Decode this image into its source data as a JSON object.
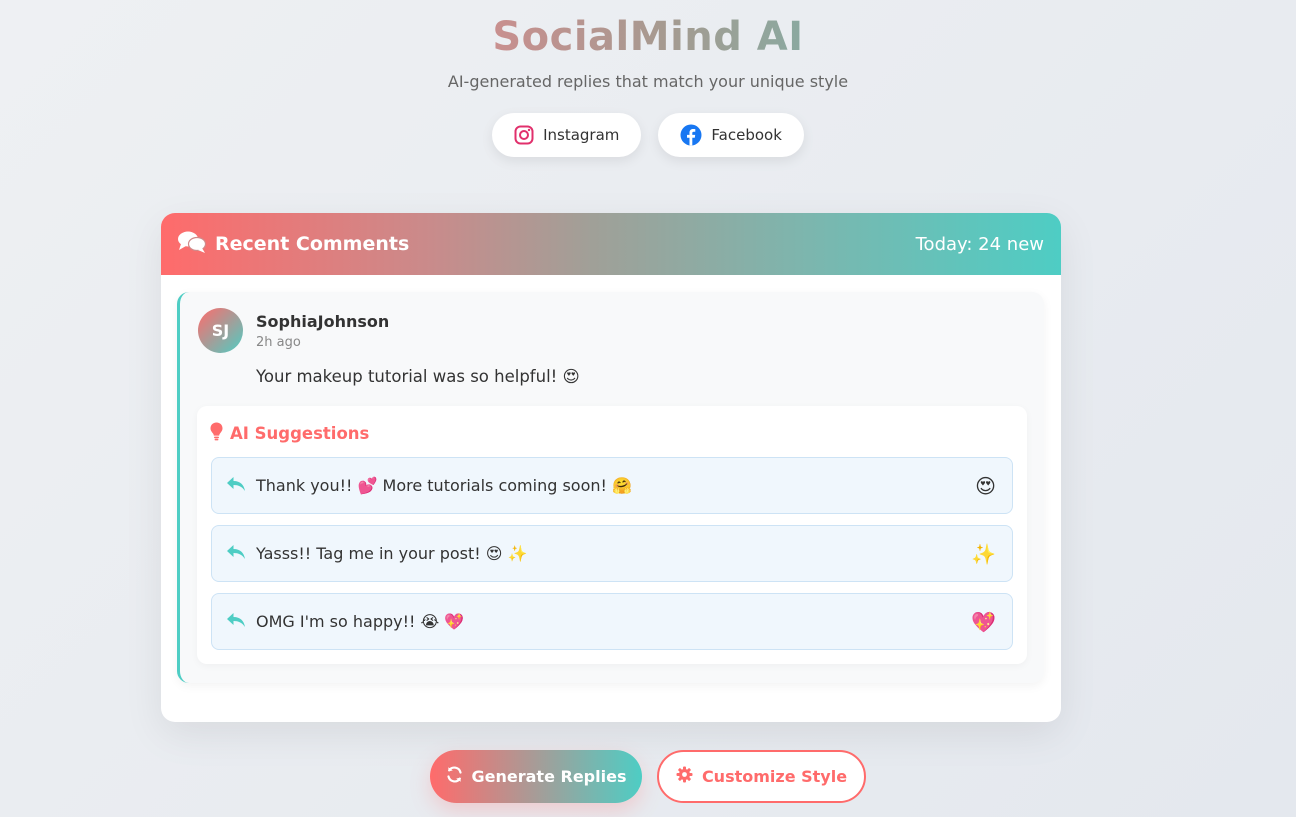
{
  "app": {
    "title": "SocialMind AI",
    "subtitle": "AI-generated replies that match your unique style"
  },
  "platforms": [
    {
      "label": "Instagram",
      "icon": "instagram-icon",
      "color": "#e1306c"
    },
    {
      "label": "Facebook",
      "icon": "facebook-icon",
      "color": "#1877f2"
    }
  ],
  "card": {
    "title": "Recent Comments",
    "title_icon": "comments-icon",
    "count_text": "Today: 24 new"
  },
  "comment": {
    "initials": "SJ",
    "username": "SophiaJohnson",
    "time": "2h ago",
    "text": "Your makeup tutorial was so helpful! 😍"
  },
  "suggestions": {
    "title": "AI Suggestions",
    "title_icon": "lightbulb-icon",
    "items": [
      {
        "text": "Thank you!! 💕 More tutorials coming soon! 🤗",
        "emoji": "😍"
      },
      {
        "text": "Yasss!! Tag me in your post! 😍 ✨",
        "emoji": "✨"
      },
      {
        "text": "OMG I'm so happy!! 😭 💖",
        "emoji": "💖"
      }
    ]
  },
  "actions": {
    "generate_label": "Generate Replies",
    "generate_icon": "sync-icon",
    "customize_label": "Customize Style",
    "customize_icon": "gear-icon"
  },
  "colors": {
    "coral": "#ff6b6b",
    "teal": "#4ecdc4"
  }
}
